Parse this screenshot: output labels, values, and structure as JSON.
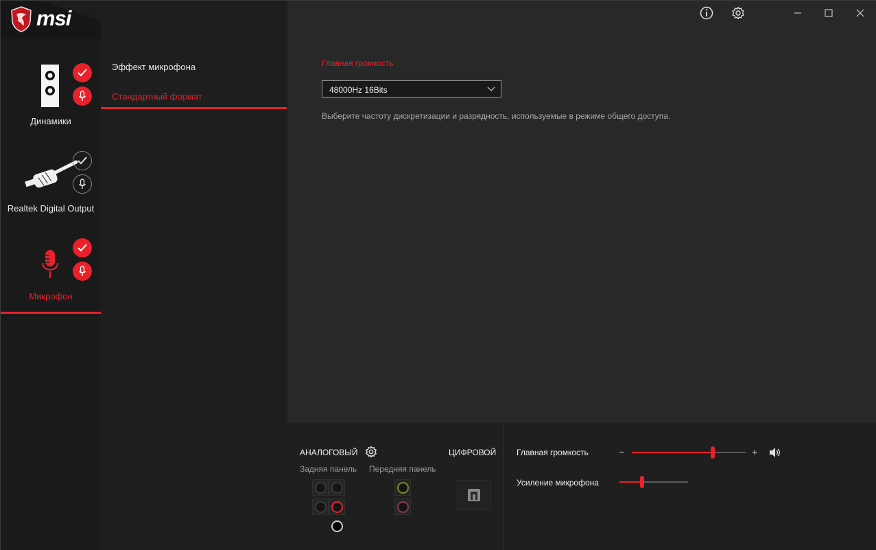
{
  "app": {
    "brand": "msi"
  },
  "window_controls": {
    "info_icon": "info-icon",
    "settings_icon": "gear-icon",
    "minimize_icon": "minimize-icon",
    "maximize_icon": "maximize-icon",
    "close_icon": "close-icon"
  },
  "devices": [
    {
      "label": "Динамики",
      "icon": "speaker-icon",
      "default_device": true,
      "default_comm": true
    },
    {
      "label": "Realtek Digital Output",
      "icon": "digital-cable-icon",
      "default_device": false,
      "default_comm": false
    },
    {
      "label": "Микрофон",
      "icon": "microphone-icon",
      "default_device": true,
      "default_comm": true,
      "active": true
    }
  ],
  "submenu": {
    "items": [
      {
        "label": "Эффект микрофона"
      },
      {
        "label": "Стандартный формат",
        "active": true
      }
    ]
  },
  "format": {
    "section_title": "Главная громкость",
    "selected": "48000Hz 16Bits",
    "description": "Выберите частоту дискретизации и разрядность, используемые в режиме общего доступа."
  },
  "jacks": {
    "analog_title": "АНАЛОГОВЫЙ",
    "digital_title": "ЦИФРОВОЙ",
    "rear_label": "Задняя панель",
    "front_label": "Передняя панель",
    "colors": {
      "front_green": "#7a8c2e",
      "front_pink": "#8a3a4a",
      "rear_red": "#e8212b"
    }
  },
  "volume": {
    "master_label": "Главная громкость",
    "master_value": 0.71,
    "minus": "−",
    "plus": "+",
    "mic_boost_label": "Усиление микрофона",
    "mic_boost_value": 0.33
  },
  "colors": {
    "accent": "#e8212b",
    "background": "#282828",
    "sidebar": "#1a1a1a"
  }
}
